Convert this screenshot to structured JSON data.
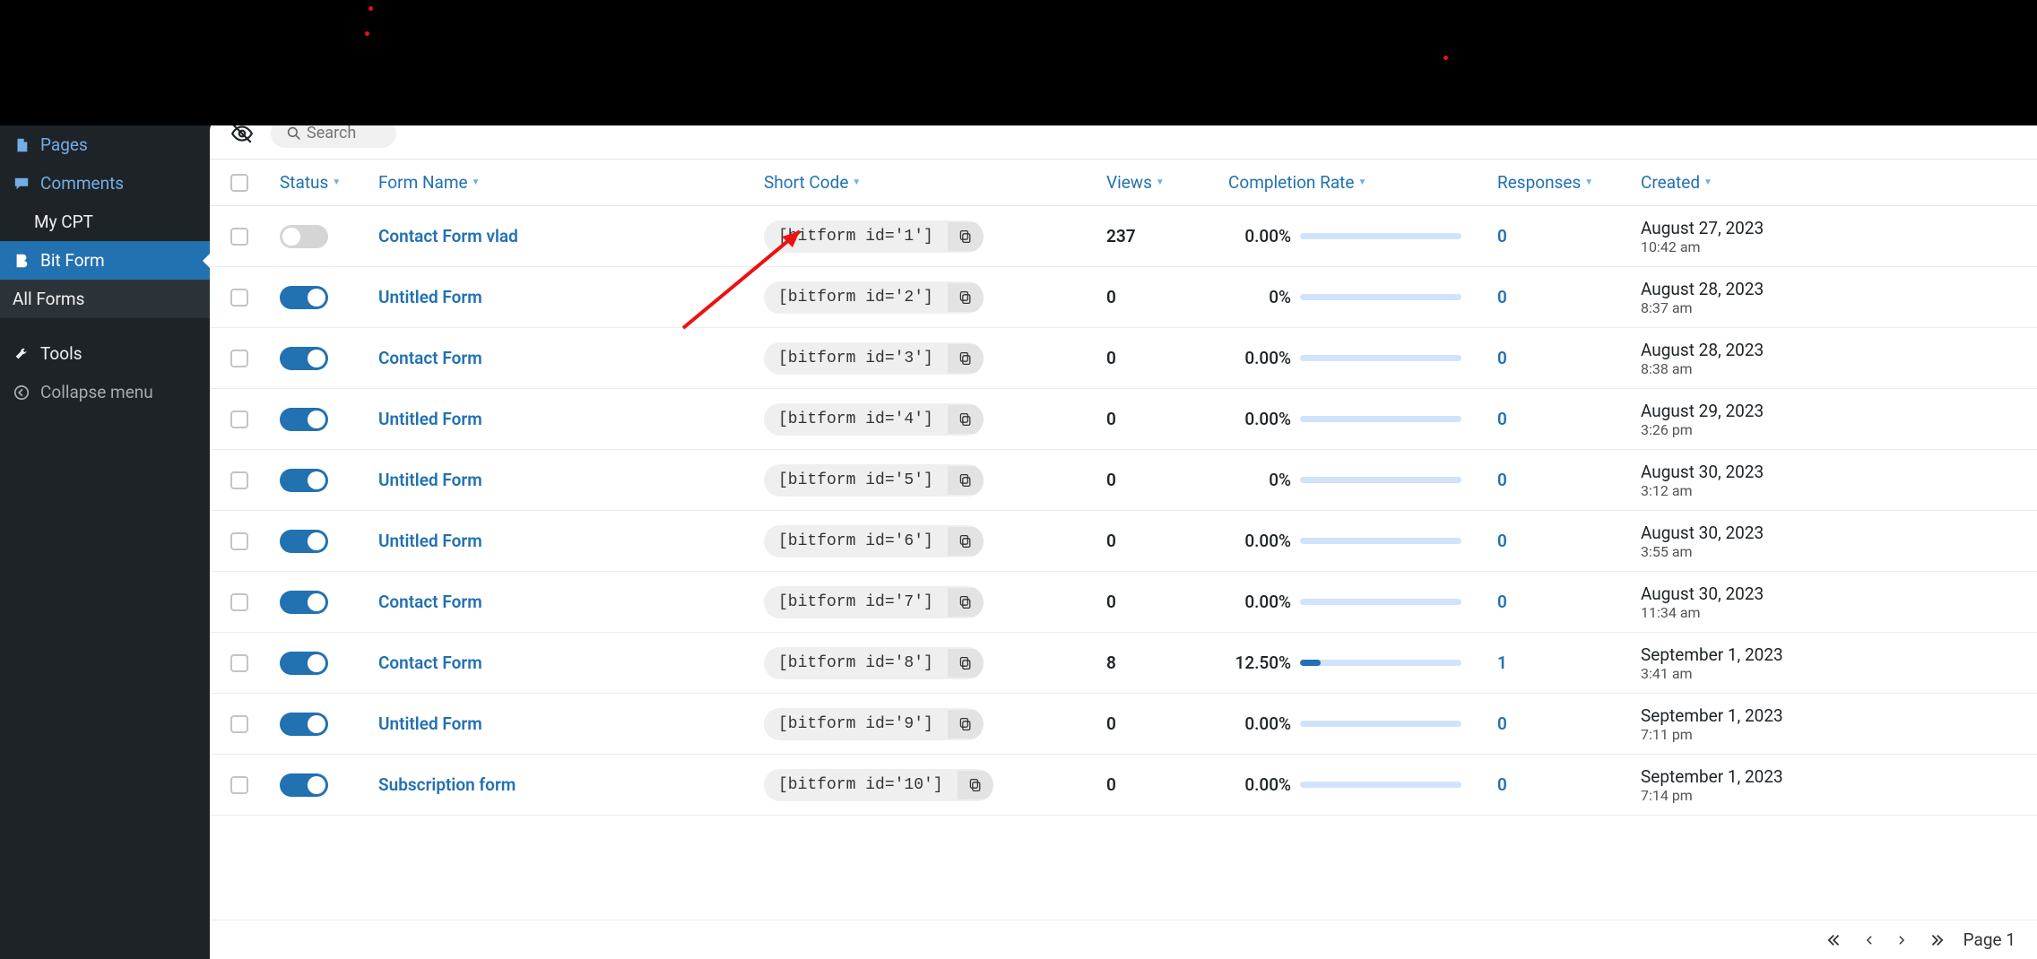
{
  "sidebar": {
    "pages": "Pages",
    "comments": "Comments",
    "mycpt": "My CPT",
    "bitform": "Bit Form",
    "allforms": "All Forms",
    "tools": "Tools",
    "collapse": "Collapse menu"
  },
  "toolbar": {
    "search_placeholder": "Search"
  },
  "headers": {
    "status": "Status",
    "name": "Form Name",
    "code": "Short Code",
    "views": "Views",
    "rate": "Completion Rate",
    "resp": "Responses",
    "created": "Created"
  },
  "rows": [
    {
      "on": false,
      "name": "Contact Form vlad",
      "code": "[bitform id='1']",
      "views": "237",
      "rate": "0.00%",
      "ratepct": 0,
      "resp": "0",
      "date": "August 27, 2023",
      "time": "10:42 am"
    },
    {
      "on": true,
      "name": "Untitled Form",
      "code": "[bitform id='2']",
      "views": "0",
      "rate": "0%",
      "ratepct": 0,
      "resp": "0",
      "date": "August 28, 2023",
      "time": "8:37 am"
    },
    {
      "on": true,
      "name": "Contact Form",
      "code": "[bitform id='3']",
      "views": "0",
      "rate": "0.00%",
      "ratepct": 0,
      "resp": "0",
      "date": "August 28, 2023",
      "time": "8:38 am"
    },
    {
      "on": true,
      "name": "Untitled Form",
      "code": "[bitform id='4']",
      "views": "0",
      "rate": "0.00%",
      "ratepct": 0,
      "resp": "0",
      "date": "August 29, 2023",
      "time": "3:26 pm"
    },
    {
      "on": true,
      "name": "Untitled Form",
      "code": "[bitform id='5']",
      "views": "0",
      "rate": "0%",
      "ratepct": 0,
      "resp": "0",
      "date": "August 30, 2023",
      "time": "3:12 am"
    },
    {
      "on": true,
      "name": "Untitled Form",
      "code": "[bitform id='6']",
      "views": "0",
      "rate": "0.00%",
      "ratepct": 0,
      "resp": "0",
      "date": "August 30, 2023",
      "time": "3:55 am"
    },
    {
      "on": true,
      "name": "Contact Form",
      "code": "[bitform id='7']",
      "views": "0",
      "rate": "0.00%",
      "ratepct": 0,
      "resp": "0",
      "date": "August 30, 2023",
      "time": "11:34 am"
    },
    {
      "on": true,
      "name": "Contact Form",
      "code": "[bitform id='8']",
      "views": "8",
      "rate": "12.50%",
      "ratepct": 12.5,
      "resp": "1",
      "date": "September 1, 2023",
      "time": "3:41 am"
    },
    {
      "on": true,
      "name": "Untitled Form",
      "code": "[bitform id='9']",
      "views": "0",
      "rate": "0.00%",
      "ratepct": 0,
      "resp": "0",
      "date": "September 1, 2023",
      "time": "7:11 pm"
    },
    {
      "on": true,
      "name": "Subscription form",
      "code": "[bitform id='10']",
      "views": "0",
      "rate": "0.00%",
      "ratepct": 0,
      "resp": "0",
      "date": "September 1, 2023",
      "time": "7:14 pm"
    }
  ],
  "pager": {
    "page": "Page 1"
  }
}
